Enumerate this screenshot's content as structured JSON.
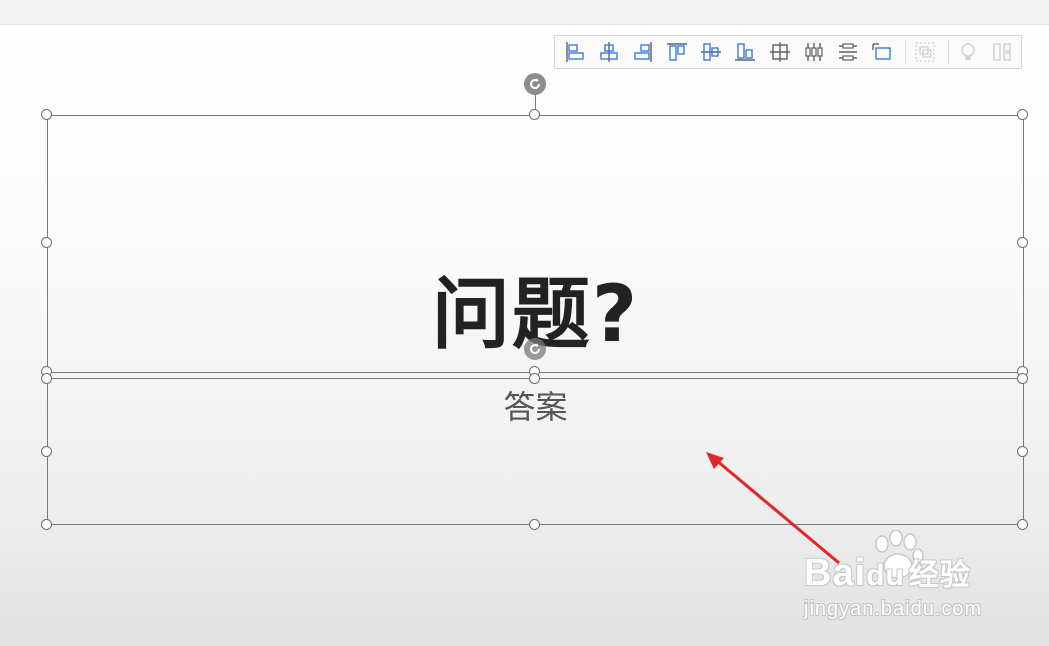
{
  "slide": {
    "title": "问题?",
    "subtitle": "答案"
  },
  "toolbar": {
    "buttons": [
      {
        "icon": "align-left-icon"
      },
      {
        "icon": "align-center-icon"
      },
      {
        "icon": "align-right-icon"
      },
      {
        "icon": "align-top-icon"
      },
      {
        "icon": "align-middle-icon"
      },
      {
        "icon": "align-bottom-icon"
      },
      {
        "icon": "align-center-both-icon"
      },
      {
        "icon": "distribute-horizontal-icon"
      },
      {
        "icon": "distribute-vertical-icon"
      },
      {
        "icon": "align-to-slide-icon"
      },
      {
        "icon": "group-icon"
      },
      {
        "icon": "smart-icon"
      },
      {
        "icon": "split-icon"
      }
    ]
  },
  "colors": {
    "arrow": "#e0262a",
    "icon_blue": "#3b7de0",
    "icon_gray": "#606060"
  },
  "watermark": {
    "brand": "Bai",
    "brand_suffix": "du",
    "brand_cn": "经验",
    "url": "jingyan.baidu.com"
  }
}
